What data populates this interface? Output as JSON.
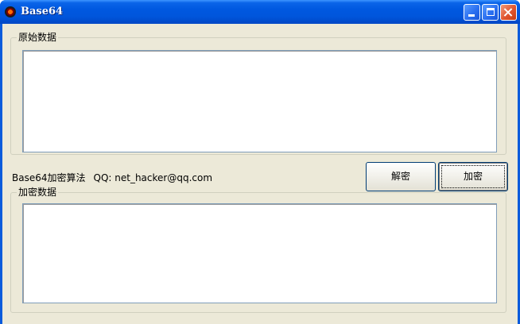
{
  "window": {
    "title": "Base64"
  },
  "groups": {
    "original": {
      "label": "原始数据",
      "value": ""
    },
    "encrypted": {
      "label": "加密数据",
      "value": ""
    }
  },
  "info": {
    "algorithm": "Base64加密算法",
    "contact": "QQ: net_hacker@qq.com"
  },
  "buttons": {
    "decode": "解密",
    "encode": "加密"
  },
  "icons": {
    "app": "app-icon",
    "minimize": "minimize-icon",
    "maximize": "maximize-icon",
    "close": "close-icon"
  },
  "colors": {
    "titlebar": "#0055db",
    "client_background": "#ece9d8",
    "close_button": "#e0552f"
  }
}
